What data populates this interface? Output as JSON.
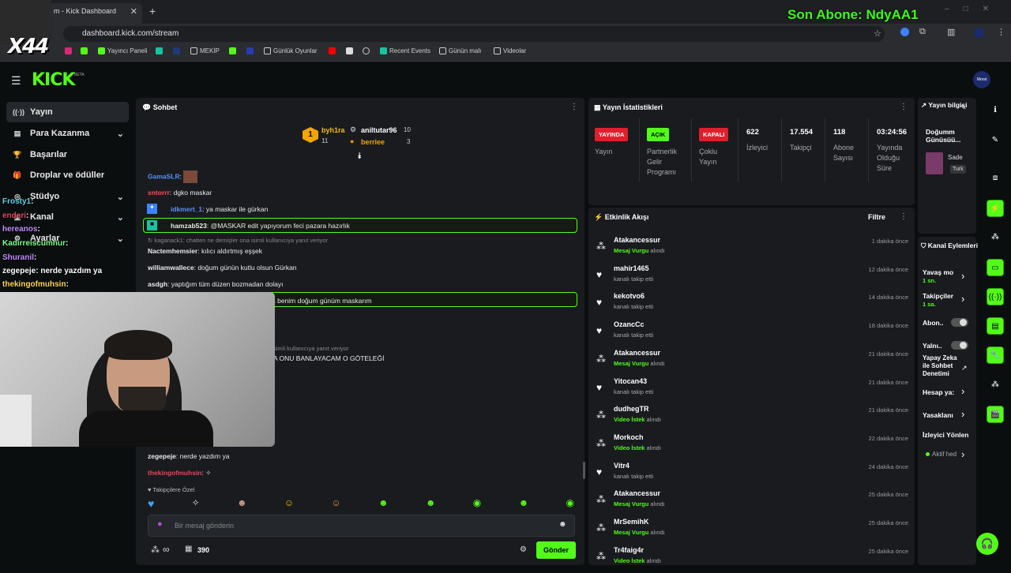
{
  "browser": {
    "tab_title": "m - Kick Dashboard",
    "new_tab": "+",
    "url": "dashboard.kick.com/stream",
    "bookmarks": [
      "Yayıncı Paneli",
      "MEKİP",
      "Günlük Oyunlar",
      "Recent Events",
      "Günün malı",
      "Videolar"
    ]
  },
  "overlay": {
    "last_sub": "Son Abone: NdyAA1",
    "x44": "X44",
    "chat": [
      {
        "user": "Frosty1",
        "msg": ":",
        "color": "#5fd3e8"
      },
      {
        "user": "enderi",
        "msg": ":",
        "color": "#e8455c"
      },
      {
        "user": "hereanos",
        "msg": ":",
        "color": "#c08cff"
      },
      {
        "user": "Kadirreiscumhur",
        "msg": ":",
        "color": "#7cff8a"
      },
      {
        "user": "Shuranil",
        "msg": ":",
        "color": "#c08cff"
      },
      {
        "user": "zegepeje",
        "msg": ": nerde yazdım ya",
        "color": "#ffffff"
      },
      {
        "user": "thekingofmuhsin",
        "msg": ":",
        "color": "#ffd84a"
      }
    ]
  },
  "header": {
    "logo": "KICK",
    "beta": "BETA",
    "avatar": "Mrest"
  },
  "nav": {
    "items": [
      {
        "label": "Yayın",
        "icon": "((·))"
      },
      {
        "label": "Para Kazanma",
        "icon": "▤"
      },
      {
        "label": "Başarılar",
        "icon": "🏆"
      },
      {
        "label": "Droplar ve ödüller",
        "icon": "🎁"
      },
      {
        "label": "Stüdyo",
        "icon": "◎"
      },
      {
        "label": "Kanal",
        "icon": "▣"
      },
      {
        "label": "Ayarlar",
        "icon": "⚙"
      }
    ]
  },
  "chat": {
    "title": "Sohbet",
    "pinned": {
      "rank1": "byh1ra",
      "count1": "11",
      "user2": "aniltutar96",
      "count2": "10",
      "user3": "berriee",
      "count3": "3",
      "medal": "1"
    },
    "messages": [
      {
        "user": "GamaSLR",
        "text": ":",
        "color": "#5b8ff9"
      },
      {
        "user": "sntorrr",
        "text": ": dgko maskar",
        "color": "#ff4d5a"
      },
      {
        "user": "idkmert_1",
        "text": ": ya maskar ile gürkan",
        "color": "#5b8ff9"
      },
      {
        "user": "hamzab523",
        "text": ": @MASKAR edit yapıyorum feci pazara hazırlık",
        "color": "#ffffff"
      },
      {
        "user": "",
        "text": "kaganack1: chatten ne demişler ona isimli kullanıcıya yanıt veriyor",
        "color": "#888"
      },
      {
        "user": "Nactemhemsier",
        "text": ": kılıcı aldırtmış eşşek",
        "color": "#ffffff"
      },
      {
        "user": "williamwallece",
        "text": ": doğum günün kutlu olsun Gürkan",
        "color": "#ffffff"
      },
      {
        "user": "asdgh",
        "text": ": yaptığım tüm düzen bozmadan dolayı",
        "color": "#ffffff"
      },
      {
        "user": "",
        "text": "a benim doğum günüm maskarım",
        "color": "#fff"
      },
      {
        "user": "",
        "text": "simli kullanıcıya yanıt veriyor",
        "color": "#888"
      },
      {
        "user": "",
        "text": "A ONU BANLAYACAM O GÖTELEĞİ",
        "color": "#fff"
      },
      {
        "user": "zegepeje",
        "text": ": nerde yazdım ya",
        "color": "#ffffff"
      },
      {
        "user": "thekingofmuhsin",
        "text": ":",
        "color": "#e8455c"
      }
    ],
    "followers_only": "Takipçilere Özel",
    "input_placeholder": "Bir mesaj gönderin",
    "points": "390",
    "infinity": "∞",
    "send": "Gönder"
  },
  "stats": {
    "title": "Yayın İstatistikleri",
    "status": [
      {
        "badge": "YAYINDA",
        "label": "Yayın",
        "color": "#e01f2d"
      },
      {
        "badge": "AÇIK",
        "label": "Partnerlik Gelir Programı",
        "color": "#53fc18"
      },
      {
        "badge": "KAPALI",
        "label": "Çoklu Yayın",
        "color": "#e01f2d"
      }
    ],
    "values": [
      {
        "value": "622",
        "label": "İzleyici"
      },
      {
        "value": "17.554",
        "label": "Takipçi"
      },
      {
        "value": "118",
        "label": "Abone Sayısı"
      },
      {
        "value": "03:24:56",
        "label": "Yayında Olduğu Süre"
      }
    ]
  },
  "activity": {
    "title": "Etkinlik Akışı",
    "filter": "Filtre",
    "items": [
      {
        "user": "Atakancessur",
        "action": "Mesaj Vurgu",
        "suffix": " alındı",
        "time": "1 dakika önce",
        "icon": "drops"
      },
      {
        "user": "mahir1465",
        "action": "",
        "suffix": "kanalı takip etti",
        "time": "12 dakika önce",
        "icon": "heart"
      },
      {
        "user": "kekotvo6",
        "action": "",
        "suffix": "kanalı takip etti",
        "time": "14 dakika önce",
        "icon": "heart"
      },
      {
        "user": "OzancCc",
        "action": "",
        "suffix": "kanalı takip etti",
        "time": "18 dakika önce",
        "icon": "heart"
      },
      {
        "user": "Atakancessur",
        "action": "Mesaj Vurgu",
        "suffix": " alındı",
        "time": "21 dakika önce",
        "icon": "drops"
      },
      {
        "user": "Yitocan43",
        "action": "",
        "suffix": "kanalı takip etti",
        "time": "21 dakika önce",
        "icon": "heart"
      },
      {
        "user": "dudhegTR",
        "action": "Video İstek",
        "suffix": " alındı",
        "time": "21 dakika önce",
        "icon": "drops"
      },
      {
        "user": "Morkoch",
        "action": "Video İstek",
        "suffix": " alındı",
        "time": "22 dakika önce",
        "icon": "drops"
      },
      {
        "user": "Vitr4",
        "action": "",
        "suffix": "kanalı takip etti",
        "time": "24 dakika önce",
        "icon": "heart"
      },
      {
        "user": "Atakancessur",
        "action": "Mesaj Vurgu",
        "suffix": " alındı",
        "time": "25 dakika önce",
        "icon": "drops"
      },
      {
        "user": "MrSemihK",
        "action": "Mesaj Vurgu",
        "suffix": " alındı",
        "time": "25 dakika önce",
        "icon": "drops"
      },
      {
        "user": "Tr4faig4r",
        "action": "Video İstek",
        "suffix": " alındı",
        "time": "25 dakika önce",
        "icon": "drops"
      }
    ]
  },
  "stream_info": {
    "title": "Yayın bilgisi",
    "stream_title": "Doğumm Günüsüü...",
    "category": "Sade",
    "lang": "Turk"
  },
  "channel_actions": {
    "title": "Kanal Eylemleri",
    "items": [
      {
        "label": "Yavaş mo",
        "value": "1 sn."
      },
      {
        "label": "Takipçiler",
        "value": "1 sa."
      },
      {
        "label": "Abon..",
        "value": ""
      },
      {
        "label": "Yalnı..",
        "value": ""
      },
      {
        "label": "Yapay Zeka ile Sohbet Denetimi",
        "value": ""
      },
      {
        "label": "Hesap ya:",
        "value": ""
      },
      {
        "label": "Yasaklanı",
        "value": ""
      },
      {
        "label": "İzleyici Yönlen",
        "value": ""
      },
      {
        "label": "Aktif hed",
        "value": ""
      }
    ]
  }
}
